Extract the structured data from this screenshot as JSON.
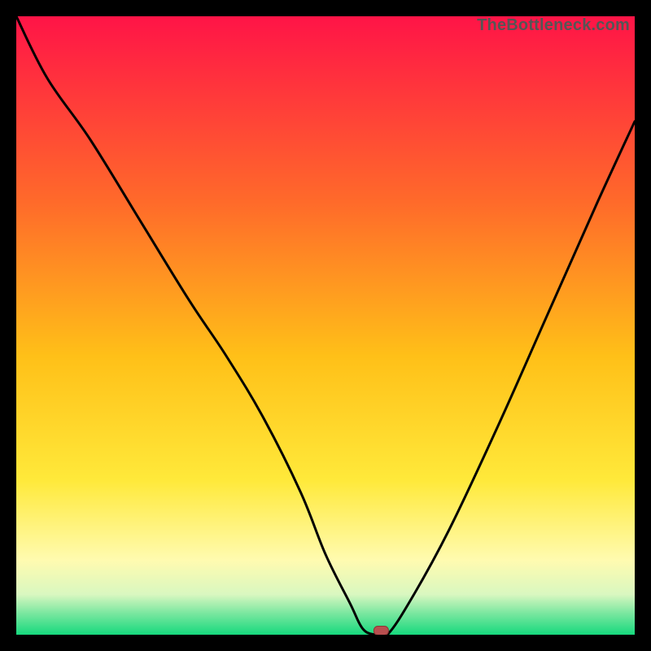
{
  "watermark": "TheBottleneck.com",
  "colors": {
    "frame_bg": "#000000",
    "gradient_stops": [
      {
        "offset": 0.0,
        "color": "#ff1447"
      },
      {
        "offset": 0.3,
        "color": "#ff6a2a"
      },
      {
        "offset": 0.55,
        "color": "#ffc018"
      },
      {
        "offset": 0.75,
        "color": "#ffe93a"
      },
      {
        "offset": 0.88,
        "color": "#fffbb0"
      },
      {
        "offset": 0.935,
        "color": "#d9f7c0"
      },
      {
        "offset": 0.965,
        "color": "#7be7a0"
      },
      {
        "offset": 1.0,
        "color": "#16d97d"
      }
    ],
    "curve_color": "#000000",
    "marker_fill": "#b84f4f",
    "marker_stroke": "#8f3434"
  },
  "chart_data": {
    "type": "line",
    "title": "",
    "xlabel": "",
    "ylabel": "",
    "xlim": [
      0,
      100
    ],
    "ylim": [
      0,
      100
    ],
    "grid": false,
    "legend": "none",
    "series": [
      {
        "name": "bottleneck-curve",
        "x": [
          0,
          5,
          12,
          20,
          28,
          34,
          40,
          46,
          50,
          54,
          56,
          58,
          60,
          64,
          70,
          78,
          86,
          94,
          100
        ],
        "y": [
          100,
          90,
          80,
          67,
          54,
          45,
          35,
          23,
          13,
          5,
          1,
          0,
          0,
          6,
          17,
          34,
          52,
          70,
          83
        ]
      }
    ],
    "marker": {
      "name": "optimal-point",
      "x": 59,
      "y": 0,
      "shape": "pill"
    }
  }
}
